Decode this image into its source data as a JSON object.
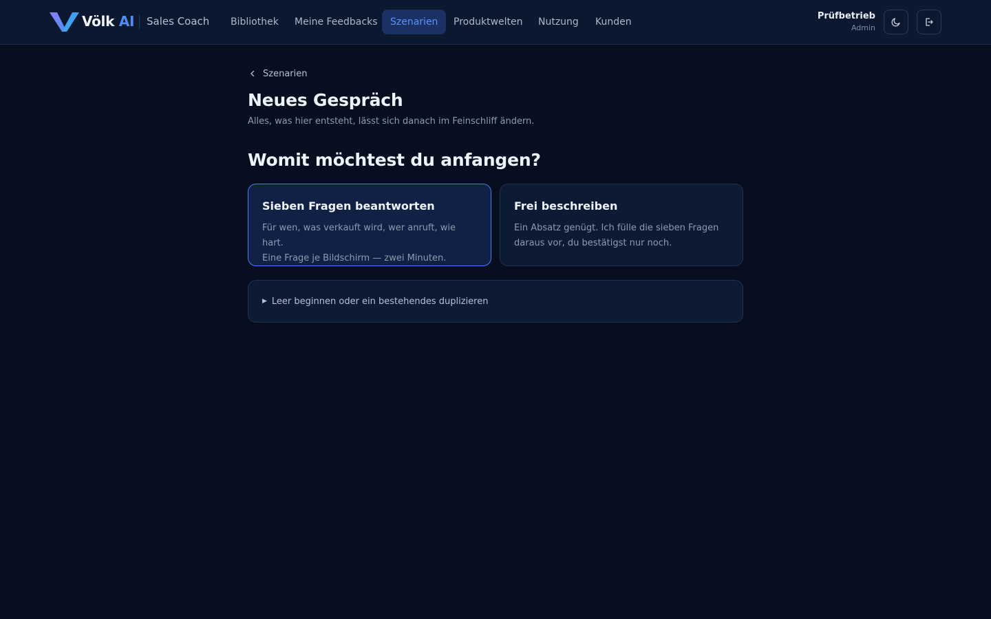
{
  "header": {
    "brand_name": "Völk",
    "brand_suffix": "AI",
    "product": "Sales Coach",
    "nav": [
      {
        "label": "Bibliothek",
        "active": false
      },
      {
        "label": "Meine Feedbacks",
        "active": false
      },
      {
        "label": "Szenarien",
        "active": true
      },
      {
        "label": "Produktwelten",
        "active": false
      },
      {
        "label": "Nutzung",
        "active": false
      },
      {
        "label": "Kunden",
        "active": false
      }
    ],
    "user": {
      "name": "Prüfbetrieb",
      "role": "Admin"
    },
    "theme_icon": "moon-icon",
    "logout_icon": "logout-icon"
  },
  "main": {
    "breadcrumb": "Szenarien",
    "title": "Neues Gespräch",
    "subtitle": "Alles, was hier entsteht, lässt sich danach im Feinschliff ändern.",
    "section_title": "Womit möchtest du anfangen?",
    "options": [
      {
        "title": "Sieben Fragen beantworten",
        "desc_line1": "Für wen, was verkauft wird, wer anruft, wie hart.",
        "desc_line2": "Eine Frage je Bildschirm — zwei Minuten.",
        "selected": true
      },
      {
        "title": "Frei beschreiben",
        "desc_line1": "Ein Absatz genügt. Ich fülle die sieben Fragen",
        "desc_line2": "daraus vor, du bestätigst nur noch.",
        "selected": false
      }
    ],
    "more": {
      "caret": "▶",
      "label": "Leer beginnen oder ein bestehendes duplizieren"
    }
  },
  "colors": {
    "background": "#060e1f",
    "header": "#0c1730",
    "accent": "#4f8df7",
    "active_nav_bg": "#1b3163"
  }
}
